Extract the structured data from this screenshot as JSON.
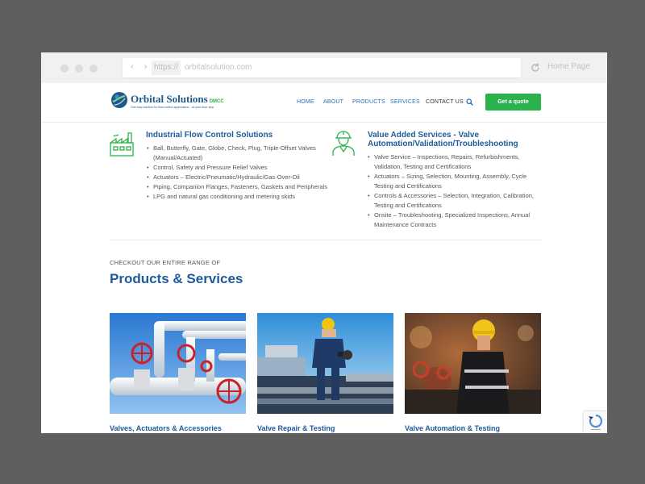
{
  "browser": {
    "scheme": "https://",
    "host": "orbitalsolution.com",
    "home_page_label": "Home Page"
  },
  "header": {
    "logo_name": "Orbital Solutions",
    "logo_suffix": "DMCC",
    "logo_tagline": "One stop solution for flow control applications....at your door step",
    "nav": [
      "HOME",
      "ABOUT",
      "PRODUCTS",
      "SERVICES",
      "CONTACT US"
    ],
    "cta_label": "Get a quote"
  },
  "services": [
    {
      "title": "Industrial Flow Control Solutions",
      "items": [
        "Ball, Butterfly, Gate, Globe, Check, Plug, Triple-Offset Valves (Manual/Actuated)",
        "Control, Safety and Pressure Relief Valves",
        "Actuators – Electric/Pneumatic/Hydraulic/Gas-Over-Oil",
        "Piping, Companion Flanges, Fasteners, Gaskets and Peripherals",
        "LPG and natural gas conditioning and metering skids"
      ]
    },
    {
      "title": "Value Added Services - Valve Automation/Validation/Troubleshooting",
      "items": [
        "Valve Service – Inspections, Repairs, Refurbishments, Validation, Testing and Certifications",
        "Actuators – Sizing, Selection, Mounting, Assembly, Cycle Testing and Certifications",
        "Controls & Accessories – Selection, Integration, Calibration, Testing and Certifications",
        "Onsite – Troubleshooting, Specialized Inspections, Annual Maintenance Contracts"
      ]
    }
  ],
  "range": {
    "eyebrow": "CHECKOUT OUR ENTIRE RANGE OF",
    "title": "Products & Services"
  },
  "cards": [
    {
      "title": "Valves, Actuators & Accessories"
    },
    {
      "title": "Valve Repair & Testing"
    },
    {
      "title": "Valve Automation & Testing"
    }
  ],
  "colors": {
    "brand_blue": "#1f5a9a",
    "accent_green": "#2bb24c",
    "backdrop": "#5f5f5f"
  }
}
